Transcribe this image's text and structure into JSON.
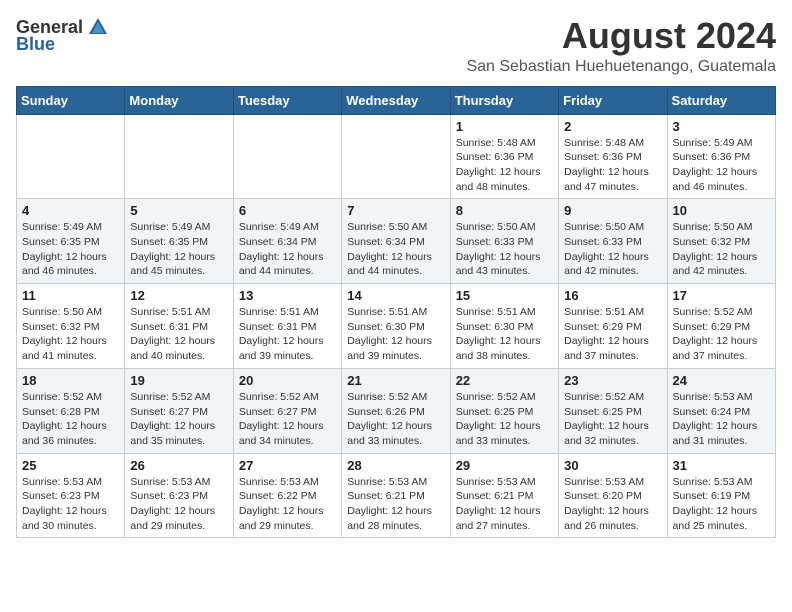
{
  "header": {
    "logo_general": "General",
    "logo_blue": "Blue",
    "month_year": "August 2024",
    "location": "San Sebastian Huehuetenango, Guatemala"
  },
  "days_of_week": [
    "Sunday",
    "Monday",
    "Tuesday",
    "Wednesday",
    "Thursday",
    "Friday",
    "Saturday"
  ],
  "weeks": [
    [
      {
        "day": "",
        "info": ""
      },
      {
        "day": "",
        "info": ""
      },
      {
        "day": "",
        "info": ""
      },
      {
        "day": "",
        "info": ""
      },
      {
        "day": "1",
        "info": "Sunrise: 5:48 AM\nSunset: 6:36 PM\nDaylight: 12 hours\nand 48 minutes."
      },
      {
        "day": "2",
        "info": "Sunrise: 5:48 AM\nSunset: 6:36 PM\nDaylight: 12 hours\nand 47 minutes."
      },
      {
        "day": "3",
        "info": "Sunrise: 5:49 AM\nSunset: 6:36 PM\nDaylight: 12 hours\nand 46 minutes."
      }
    ],
    [
      {
        "day": "4",
        "info": "Sunrise: 5:49 AM\nSunset: 6:35 PM\nDaylight: 12 hours\nand 46 minutes."
      },
      {
        "day": "5",
        "info": "Sunrise: 5:49 AM\nSunset: 6:35 PM\nDaylight: 12 hours\nand 45 minutes."
      },
      {
        "day": "6",
        "info": "Sunrise: 5:49 AM\nSunset: 6:34 PM\nDaylight: 12 hours\nand 44 minutes."
      },
      {
        "day": "7",
        "info": "Sunrise: 5:50 AM\nSunset: 6:34 PM\nDaylight: 12 hours\nand 44 minutes."
      },
      {
        "day": "8",
        "info": "Sunrise: 5:50 AM\nSunset: 6:33 PM\nDaylight: 12 hours\nand 43 minutes."
      },
      {
        "day": "9",
        "info": "Sunrise: 5:50 AM\nSunset: 6:33 PM\nDaylight: 12 hours\nand 42 minutes."
      },
      {
        "day": "10",
        "info": "Sunrise: 5:50 AM\nSunset: 6:32 PM\nDaylight: 12 hours\nand 42 minutes."
      }
    ],
    [
      {
        "day": "11",
        "info": "Sunrise: 5:50 AM\nSunset: 6:32 PM\nDaylight: 12 hours\nand 41 minutes."
      },
      {
        "day": "12",
        "info": "Sunrise: 5:51 AM\nSunset: 6:31 PM\nDaylight: 12 hours\nand 40 minutes."
      },
      {
        "day": "13",
        "info": "Sunrise: 5:51 AM\nSunset: 6:31 PM\nDaylight: 12 hours\nand 39 minutes."
      },
      {
        "day": "14",
        "info": "Sunrise: 5:51 AM\nSunset: 6:30 PM\nDaylight: 12 hours\nand 39 minutes."
      },
      {
        "day": "15",
        "info": "Sunrise: 5:51 AM\nSunset: 6:30 PM\nDaylight: 12 hours\nand 38 minutes."
      },
      {
        "day": "16",
        "info": "Sunrise: 5:51 AM\nSunset: 6:29 PM\nDaylight: 12 hours\nand 37 minutes."
      },
      {
        "day": "17",
        "info": "Sunrise: 5:52 AM\nSunset: 6:29 PM\nDaylight: 12 hours\nand 37 minutes."
      }
    ],
    [
      {
        "day": "18",
        "info": "Sunrise: 5:52 AM\nSunset: 6:28 PM\nDaylight: 12 hours\nand 36 minutes."
      },
      {
        "day": "19",
        "info": "Sunrise: 5:52 AM\nSunset: 6:27 PM\nDaylight: 12 hours\nand 35 minutes."
      },
      {
        "day": "20",
        "info": "Sunrise: 5:52 AM\nSunset: 6:27 PM\nDaylight: 12 hours\nand 34 minutes."
      },
      {
        "day": "21",
        "info": "Sunrise: 5:52 AM\nSunset: 6:26 PM\nDaylight: 12 hours\nand 33 minutes."
      },
      {
        "day": "22",
        "info": "Sunrise: 5:52 AM\nSunset: 6:25 PM\nDaylight: 12 hours\nand 33 minutes."
      },
      {
        "day": "23",
        "info": "Sunrise: 5:52 AM\nSunset: 6:25 PM\nDaylight: 12 hours\nand 32 minutes."
      },
      {
        "day": "24",
        "info": "Sunrise: 5:53 AM\nSunset: 6:24 PM\nDaylight: 12 hours\nand 31 minutes."
      }
    ],
    [
      {
        "day": "25",
        "info": "Sunrise: 5:53 AM\nSunset: 6:23 PM\nDaylight: 12 hours\nand 30 minutes."
      },
      {
        "day": "26",
        "info": "Sunrise: 5:53 AM\nSunset: 6:23 PM\nDaylight: 12 hours\nand 29 minutes."
      },
      {
        "day": "27",
        "info": "Sunrise: 5:53 AM\nSunset: 6:22 PM\nDaylight: 12 hours\nand 29 minutes."
      },
      {
        "day": "28",
        "info": "Sunrise: 5:53 AM\nSunset: 6:21 PM\nDaylight: 12 hours\nand 28 minutes."
      },
      {
        "day": "29",
        "info": "Sunrise: 5:53 AM\nSunset: 6:21 PM\nDaylight: 12 hours\nand 27 minutes."
      },
      {
        "day": "30",
        "info": "Sunrise: 5:53 AM\nSunset: 6:20 PM\nDaylight: 12 hours\nand 26 minutes."
      },
      {
        "day": "31",
        "info": "Sunrise: 5:53 AM\nSunset: 6:19 PM\nDaylight: 12 hours\nand 25 minutes."
      }
    ]
  ]
}
